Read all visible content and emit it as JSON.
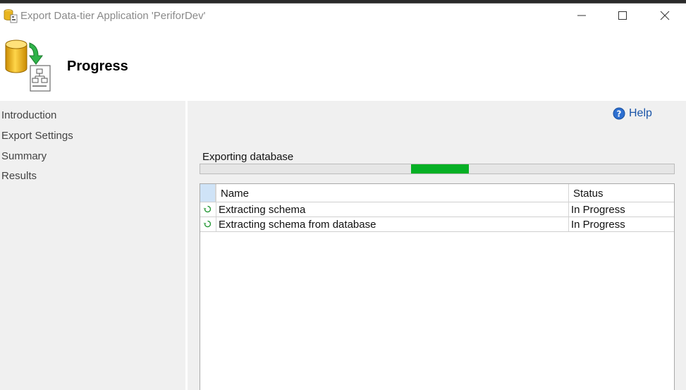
{
  "window": {
    "title": "Export Data-tier Application 'PeriforDev'",
    "app_icon": "database-export-icon",
    "controls": [
      "minimize-icon",
      "maximize-icon",
      "close-icon"
    ]
  },
  "header": {
    "title": "Progress",
    "icon": "database-to-file-icon"
  },
  "nav": {
    "items": [
      {
        "label": "Introduction"
      },
      {
        "label": "Export Settings"
      },
      {
        "label": "Summary"
      },
      {
        "label": "Results"
      }
    ]
  },
  "main": {
    "help_label": "Help",
    "help_icon": "help-circle-icon",
    "operation_label": "Exporting database",
    "progress": {
      "indeterminate": true,
      "fill_color": "#06b025"
    },
    "table": {
      "columns": [
        "Name",
        "Status"
      ],
      "rows": [
        {
          "icon": "in-progress-spinner-icon",
          "name": "Extracting schema",
          "status": "In Progress"
        },
        {
          "icon": "in-progress-spinner-icon",
          "name": "Extracting schema from database",
          "status": "In Progress"
        }
      ]
    }
  },
  "colors": {
    "accent": "#1a55a8",
    "progress_green": "#06b025",
    "panel_bg": "#f0f0f0"
  }
}
